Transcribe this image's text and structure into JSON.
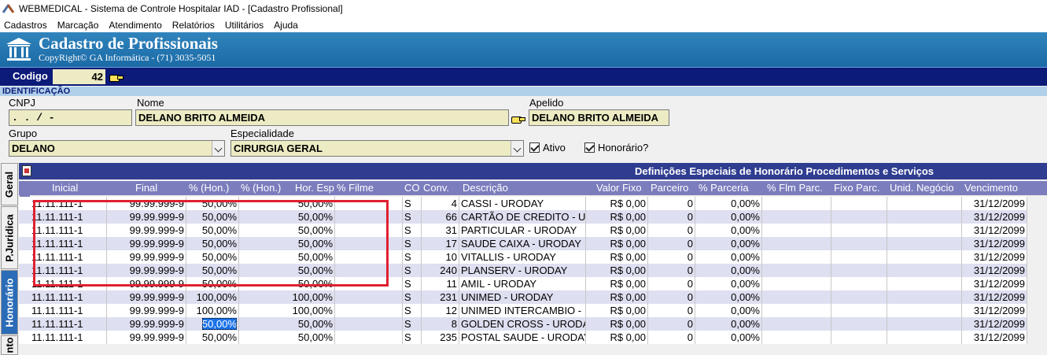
{
  "window": {
    "title": "WEBMEDICAL - Sistema de Controle Hospitalar IAD - [Cadastro Profissional]"
  },
  "menu": [
    "Cadastros",
    "Marcação",
    "Atendimento",
    "Relatórios",
    "Utilitários",
    "Ajuda"
  ],
  "banner": {
    "title": "Cadastro de Profissionais",
    "subtitle": "CopyRight© GA Informática - (71) 3035-5051"
  },
  "codigo": {
    "label": "Codigo",
    "value": "42"
  },
  "section": "IDENTIFICAÇÃO",
  "fields": {
    "cnpj_label": "CNPJ",
    "cnpj_value": " .  .  /   -",
    "nome_label": "Nome",
    "nome_value": "DELANO BRITO ALMEIDA",
    "apelido_label": "Apelido",
    "apelido_value": "DELANO BRITO ALMEIDA",
    "grupo_label": "Grupo",
    "grupo_value": "DELANO",
    "especialidade_label": "Especialidade",
    "especialidade_value": "CIRURGIA GERAL",
    "ativo_label": "Ativo",
    "ativo_checked": true,
    "honorario_label": "Honorário?",
    "honorario_checked": true
  },
  "tabs": [
    "Geral",
    "P.Juridica",
    "Honorário",
    "nto"
  ],
  "active_tab": "Honorário",
  "grid": {
    "title": "Definições Especiais de Honorário Procedimentos e Serviços",
    "columns": [
      "Inicial",
      "Final",
      "% (Hon.)",
      "% (Hon.)",
      "Hor. Esp",
      "% Filme",
      "CO",
      "Conv.",
      "Descrição",
      "Valor Fixo",
      "Parceiro",
      "% Parceria",
      "% Flm Parc.",
      "Fixo Parc.",
      "Unid. Negócio",
      "Vencimento"
    ],
    "rows": [
      {
        "inicial": "11.11.111-1",
        "final": "99.99.999-9",
        "hon1": "50,00%",
        "hon2": "50,00%",
        "co": "S",
        "conv": "4",
        "descricao": "CASSI - URODAY",
        "valor_fixo": "R$ 0,00",
        "parceiro": "0",
        "parceria": "0,00%",
        "vencimento": "31/12/2099"
      },
      {
        "inicial": "11.11.111-1",
        "final": "99.99.999-9",
        "hon1": "50,00%",
        "hon2": "50,00%",
        "co": "S",
        "conv": "66",
        "descricao": "CARTÃO DE CREDITO - U",
        "valor_fixo": "R$ 0,00",
        "parceiro": "0",
        "parceria": "0,00%",
        "vencimento": "31/12/2099"
      },
      {
        "inicial": "11.11.111-1",
        "final": "99.99.999-9",
        "hon1": "50,00%",
        "hon2": "50,00%",
        "co": "S",
        "conv": "31",
        "descricao": "PARTICULAR - URODAY",
        "valor_fixo": "R$ 0,00",
        "parceiro": "0",
        "parceria": "0,00%",
        "vencimento": "31/12/2099"
      },
      {
        "inicial": "11.11.111-1",
        "final": "99.99.999-9",
        "hon1": "50,00%",
        "hon2": "50,00%",
        "co": "S",
        "conv": "17",
        "descricao": "SAUDE CAIXA - URODAY",
        "valor_fixo": "R$ 0,00",
        "parceiro": "0",
        "parceria": "0,00%",
        "vencimento": "31/12/2099"
      },
      {
        "inicial": "11.11.111-1",
        "final": "99.99.999-9",
        "hon1": "50,00%",
        "hon2": "50,00%",
        "co": "S",
        "conv": "10",
        "descricao": "VITALLIS - URODAY",
        "valor_fixo": "R$ 0,00",
        "parceiro": "0",
        "parceria": "0,00%",
        "vencimento": "31/12/2099"
      },
      {
        "inicial": "11.11.111-1",
        "final": "99.99.999-9",
        "hon1": "50,00%",
        "hon2": "50,00%",
        "co": "S",
        "conv": "240",
        "descricao": "PLANSERV - URODAY",
        "valor_fixo": "R$ 0,00",
        "parceiro": "0",
        "parceria": "0,00%",
        "vencimento": "31/12/2099"
      },
      {
        "inicial": "11.11.111-1",
        "final": "99.99.999-9",
        "hon1": "50,00%",
        "hon2": "50,00%",
        "co": "S",
        "conv": "11",
        "descricao": "AMIL -  URODAY",
        "valor_fixo": "R$ 0,00",
        "parceiro": "0",
        "parceria": "0,00%",
        "vencimento": "31/12/2099"
      },
      {
        "inicial": "11.11.111-1",
        "final": "99.99.999-9",
        "hon1": "100,00%",
        "hon2": "100,00%",
        "co": "S",
        "conv": "231",
        "descricao": "UNIMED - URODAY",
        "valor_fixo": "R$ 0,00",
        "parceiro": "0",
        "parceria": "0,00%",
        "vencimento": "31/12/2099"
      },
      {
        "inicial": "11.11.111-1",
        "final": "99.99.999-9",
        "hon1": "100,00%",
        "hon2": "100,00%",
        "co": "S",
        "conv": "12",
        "descricao": "UNIMED INTERCAMBIO -",
        "valor_fixo": "R$ 0,00",
        "parceiro": "0",
        "parceria": "0,00%",
        "vencimento": "31/12/2099"
      },
      {
        "inicial": "11.11.111-1",
        "final": "99.99.999-9",
        "hon1": "50,00%",
        "hon2": "50,00%",
        "co": "S",
        "conv": "8",
        "descricao": "GOLDEN CROSS - URODA",
        "valor_fixo": "R$ 0,00",
        "parceiro": "0",
        "parceria": "0,00%",
        "vencimento": "31/12/2099"
      },
      {
        "inicial": "11.11.111-1",
        "final": "99.99.999-9",
        "hon1": "50,00%",
        "hon2": "50,00%",
        "co": "S",
        "conv": "235",
        "descricao": "POSTAL SAUDE - URODAY",
        "valor_fixo": "R$ 0,00",
        "parceiro": "0",
        "parceria": "0,00%",
        "vencimento": "31/12/2099"
      }
    ],
    "current_row": 9,
    "row_colors": {
      "odd": "#ffffff",
      "even": "#dedff0"
    }
  }
}
